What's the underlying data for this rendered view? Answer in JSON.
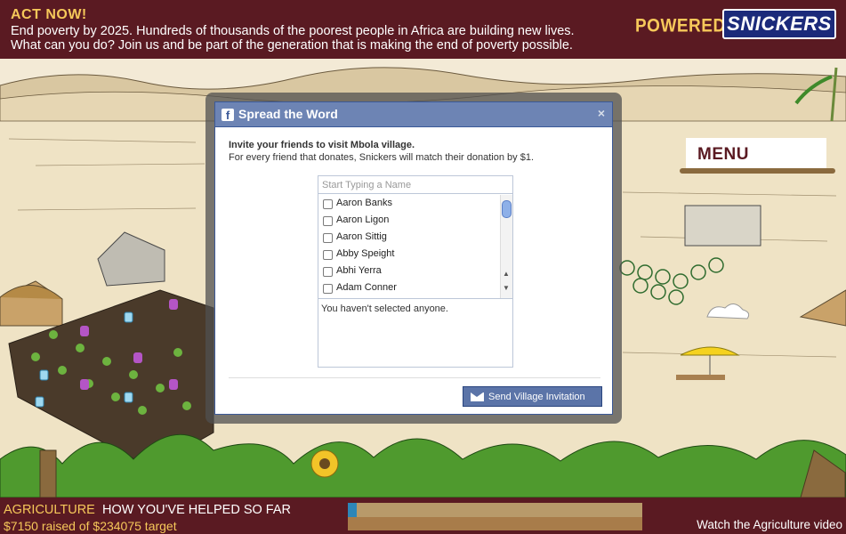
{
  "banner": {
    "heading": "ACT NOW!",
    "line1": "End poverty by 2025. Hundreds of thousands of the poorest people in Africa are building new lives.",
    "line2": "What can you do? Join us and be part of the generation that is making the end of poverty possible.",
    "powered_by": "POWERED BY",
    "brand": "SNICKERS"
  },
  "menu": {
    "label": "MENU"
  },
  "dialog": {
    "title": "Spread the Word",
    "close": "×",
    "invite_heading": "Invite your friends to visit Mbola village.",
    "invite_desc": "For every friend that donates, Snickers will match their donation by $1.",
    "search_placeholder": "Start Typing a Name",
    "friends": [
      "Aaron Banks",
      "Aaron Ligon",
      "Aaron Sittig",
      "Abby Speight",
      "Abhi Yerra",
      "Adam Conner"
    ],
    "selected_text": "You haven't selected anyone.",
    "send_label": "Send Village Invitation",
    "fb_glyph": "f"
  },
  "footer": {
    "category": "AGRICULTURE",
    "how_helped": "HOW YOU'VE HELPED SO FAR",
    "raised_text": "$7150 raised of $234075 target",
    "raised": 7150,
    "target": 234075,
    "video_link": "Watch the Agriculture video"
  },
  "colors": {
    "banner_bg": "#5a1a22",
    "accent_gold": "#f6c85a",
    "fb_blue": "#3b5998",
    "fb_header": "#6d84b4",
    "button_blue": "#5b74a8"
  },
  "icons": [
    "facebook-icon",
    "close-icon",
    "envelope-icon",
    "scroll-up-icon",
    "scroll-down-icon"
  ]
}
